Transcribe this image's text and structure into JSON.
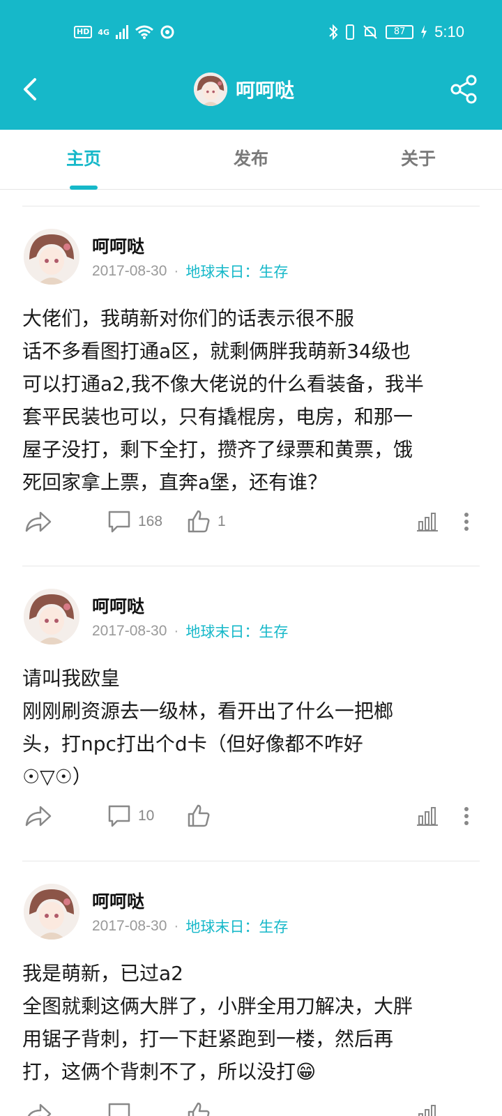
{
  "status_bar": {
    "left_badge": "HD",
    "network": "4G",
    "battery": "87",
    "time": "5:10"
  },
  "header": {
    "title": "呵呵哒"
  },
  "tabs": [
    {
      "label": "主页"
    },
    {
      "label": "发布"
    },
    {
      "label": "关于"
    }
  ],
  "posts": [
    {
      "author": "呵呵哒",
      "date": "2017-08-30",
      "separator": "·",
      "tag": "地球末日：生存",
      "lines": [
        "大佬们，我萌新对你们的话表示很不服",
        "话不多看图打通a区，就剩俩胖我萌新34级也",
        "可以打通a2,我不像大佬说的什么看装备，我半",
        "套平民装也可以，只有撬棍房，电房，和那一",
        "屋子没打，剩下全打，攒齐了绿票和黄票，饿",
        "死回家拿上票，直奔a堡，还有谁？"
      ],
      "comments": "168",
      "likes": "1"
    },
    {
      "author": "呵呵哒",
      "date": "2017-08-30",
      "separator": "·",
      "tag": "地球末日：生存",
      "lines": [
        "请叫我欧皇",
        "刚刚刷资源去一级林，看开出了什么一把榔",
        "头，打npc打出个d卡（但好像都不咋好",
        "☉▽☉）"
      ],
      "comments": "10",
      "likes": ""
    },
    {
      "author": "呵呵哒",
      "date": "2017-08-30",
      "separator": "·",
      "tag": "地球末日：生存",
      "lines": [
        "我是萌新，已过a2",
        "全图就剩这俩大胖了，小胖全用刀解决，大胖",
        "用锯子背刺，打一下赶紧跑到一楼，然后再",
        "打，这俩个背刺不了，所以没打😁"
      ],
      "comments": "",
      "likes": ""
    }
  ],
  "colors": {
    "accent": "#16b8c9",
    "meta_gray": "#999999",
    "icon_gray": "#888888"
  },
  "icons": [
    "back-icon",
    "share-icon",
    "repost-icon",
    "comment-icon",
    "like-icon",
    "stats-icon",
    "more-icon"
  ]
}
